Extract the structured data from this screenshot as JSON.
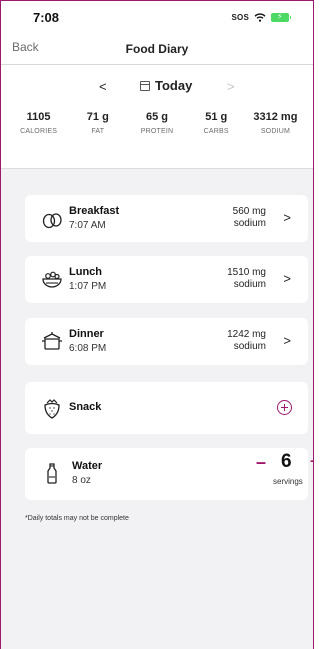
{
  "status_bar": {
    "time": "7:08",
    "sos": "SOS",
    "battery_color": "#4cd964"
  },
  "nav": {
    "back": "Back",
    "title": "Food Diary"
  },
  "date_selector": {
    "prev_icon": "chevron-left",
    "label": "Today",
    "calendar_icon": "calendar-icon",
    "next_icon": "chevron-right"
  },
  "totals": [
    {
      "value": "1105",
      "label": "CALORIES"
    },
    {
      "value": "71 g",
      "label": "FAT"
    },
    {
      "value": "65 g",
      "label": "PROTEIN"
    },
    {
      "value": "51 g",
      "label": "CARBS"
    },
    {
      "value": "3312 mg",
      "label": "SODIUM"
    }
  ],
  "meals": [
    {
      "name": "Breakfast",
      "time": "7:07 AM",
      "sodium_value": "560 mg",
      "sodium_label": "sodium",
      "icon": "breakfast-eggs-icon"
    },
    {
      "name": "Lunch",
      "time": "1:07 PM",
      "sodium_value": "1510 mg",
      "sodium_label": "sodium",
      "icon": "lunch-salad-bowl-icon"
    },
    {
      "name": "Dinner",
      "time": "6:08 PM",
      "sodium_value": "1242 mg",
      "sodium_label": "sodium",
      "icon": "dinner-pot-icon"
    }
  ],
  "snack": {
    "name": "Snack",
    "icon": "snack-strawberry-icon"
  },
  "water": {
    "name": "Water",
    "amount": "8 oz",
    "servings": "6",
    "servings_label": "servings",
    "minus": "–",
    "plus": "+",
    "icon": "water-bottle-icon"
  },
  "footnote": "*Daily totals may not be complete",
  "colors": {
    "accent": "#9b1a6e",
    "background_gray": "#f2f2f4"
  }
}
